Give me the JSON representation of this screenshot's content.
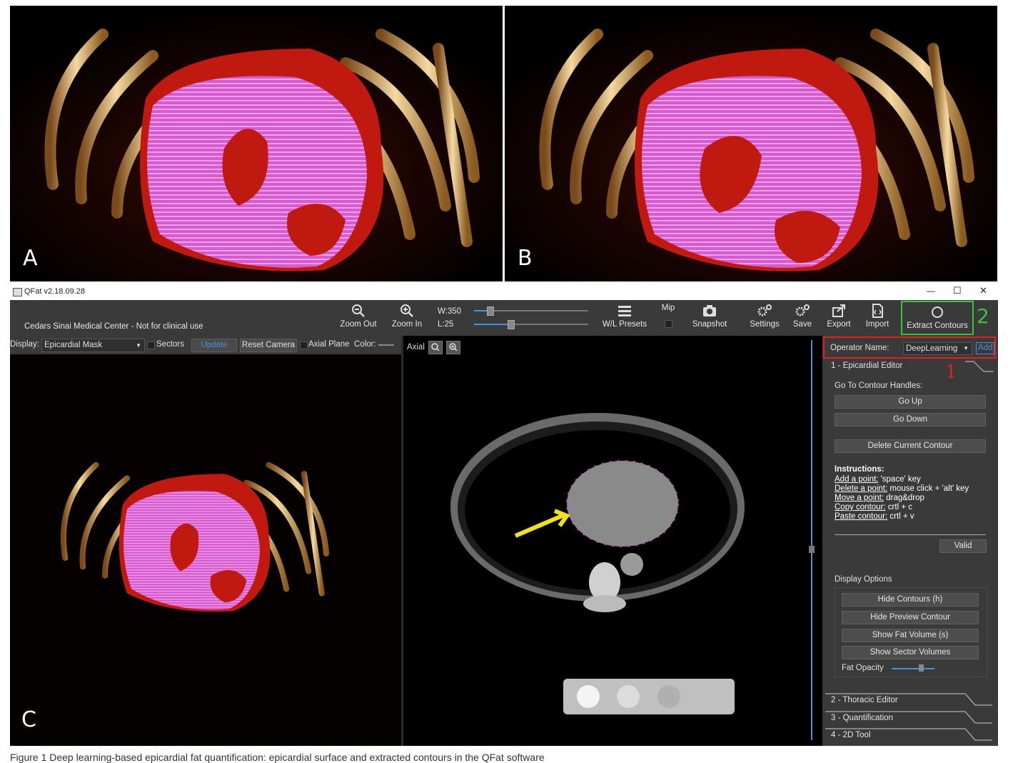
{
  "panels": {
    "a_label": "A",
    "b_label": "B",
    "c_label": "C"
  },
  "window": {
    "title": "QFat v2.18.09.28",
    "minimize": "—",
    "maximize": "☐",
    "close": "✕"
  },
  "toolbar": {
    "org_text": "Cedars Sinai Medical Center - Not for clinical use",
    "zoom_out": "Zoom Out",
    "zoom_in": "Zoom In",
    "window_w": "W:350",
    "window_l": "L:25",
    "wl_presets": "W/L Presets",
    "mip": "Mip",
    "snapshot": "Snapshot",
    "settings": "Settings",
    "save": "Save",
    "export": "Export",
    "import": "Import",
    "extract_contours": "Extract Contours",
    "annotation_2": "2"
  },
  "display_bar": {
    "display_label": "Display:",
    "display_value": "Epicardial Mask",
    "sectors": "Sectors",
    "update": "Update",
    "reset_camera": "Reset Camera",
    "axial_plane": "Axial Plane",
    "color": "Color:"
  },
  "axial_view": {
    "label": "Axial"
  },
  "side": {
    "operator_label": "Operator Name:",
    "operator_value": "DeepLearning",
    "add": "Add",
    "annotation_1": "1",
    "section1": "1 - Epicardial Editor",
    "go_to_handles": "Go To Contour Handles:",
    "go_up": "Go Up",
    "go_down": "Go Down",
    "delete_contour": "Delete Current Contour",
    "instructions_title": "Instructions:",
    "instructions": [
      {
        "action": "Add a point:",
        "keys": " 'space' key"
      },
      {
        "action": "Delete a point:",
        "keys": " mouse click + 'alt' key"
      },
      {
        "action": "Move a point:",
        "keys": " drag&drop"
      },
      {
        "action": "Copy contour:",
        "keys": " crtl + c"
      },
      {
        "action": "Paste contour:",
        "keys": " crtl + v"
      }
    ],
    "valid": "Valid",
    "display_options": "Display Options",
    "hide_contours": "Hide Contours (h)",
    "hide_preview": "Hide Preview Contour",
    "show_fat": "Show Fat Volume (s)",
    "show_sector": "Show Sector Volumes",
    "fat_opacity": "Fat Opacity",
    "section2": "2 - Thoracic Editor",
    "section3": "3 - Quantification",
    "section4": "4 - 2D Tool"
  },
  "caption": "Figure 1  Deep learning-based epicardial fat quantification: epicardial surface and extracted contours in the QFat software"
}
